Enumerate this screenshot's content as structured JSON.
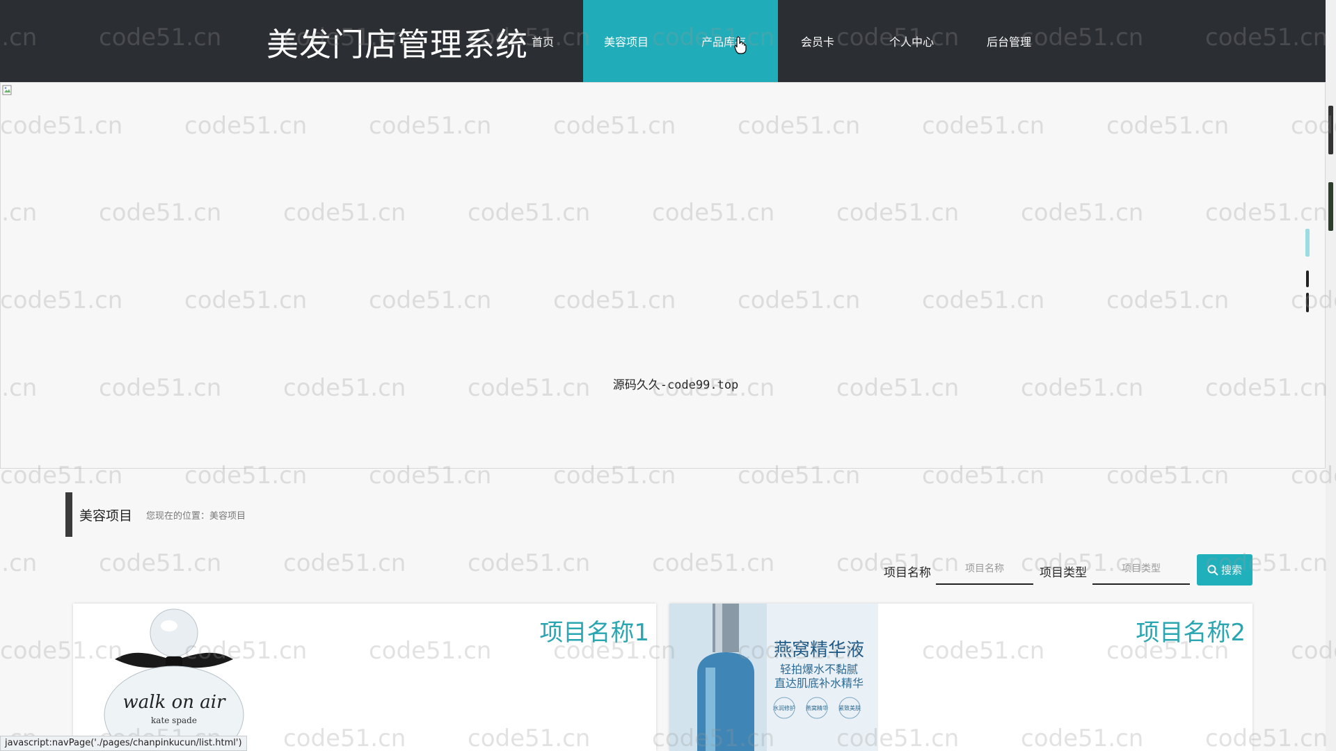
{
  "header": {
    "brand": "美发门店管理系统",
    "nav": [
      {
        "label": "首页"
      },
      {
        "label": "美容项目"
      },
      {
        "label": "产品库存"
      },
      {
        "label": "会员卡"
      },
      {
        "label": "个人中心"
      },
      {
        "label": "后台管理"
      }
    ]
  },
  "banner": {
    "caption": "源码久久-code99.top"
  },
  "section": {
    "title": "美容项目",
    "breadcrumb": "您现在的位置：美容项目"
  },
  "search": {
    "name_label": "项目名称",
    "name_placeholder": "项目名称",
    "type_label": "项目类型",
    "type_placeholder": "项目类型",
    "button_label": "搜索"
  },
  "cards": [
    {
      "title": "项目名称1",
      "image_text": "walk on air",
      "image_subtext": "kate spade"
    },
    {
      "title": "项目名称2",
      "image_text": "燕窝精华液",
      "image_subtext1": "轻拍爆水不黏腻",
      "image_subtext2": "直达肌底补水精华",
      "badges": [
        "水润修护",
        "燕窝精华",
        "紧致美肤"
      ]
    }
  ],
  "watermark": "code51.cn",
  "status_bar": "javascript:navPage('./pages/chanpinkucun/list.html')",
  "colors": {
    "header_bg": "#2b2f33",
    "accent": "#20adb9",
    "card_title": "#2aa6b3"
  }
}
